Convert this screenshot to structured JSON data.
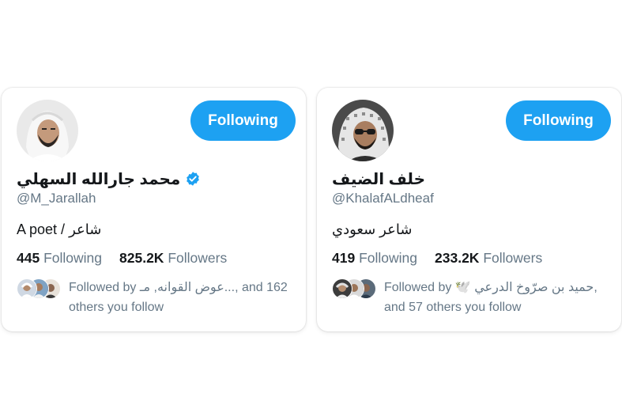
{
  "cards": [
    {
      "name": "محمد جارالله السهلي",
      "verified": true,
      "handle": "@M_Jarallah",
      "bio": "A poet / شاعر",
      "follow_button": "Following",
      "following_count": "445",
      "following_label": "Following",
      "followers_count": "825.2K",
      "followers_label": "Followers",
      "followed_by_line1": "Followed by عوض القوانه, مـ..., and 162",
      "followed_by_line2": "others you follow"
    },
    {
      "name": "خلف الضيف",
      "verified": false,
      "handle": "@KhalafALdheaf",
      "bio": "شاعر سعودي",
      "follow_button": "Following",
      "following_count": "419",
      "following_label": "Following",
      "followers_count": "233.2K",
      "followers_label": "Followers",
      "followed_by_line1": "Followed by 🕊️ حميد بن صرّوخ الدرعي,",
      "followed_by_line2": "and 57 others you follow"
    }
  ],
  "colors": {
    "accent": "#1da1f2",
    "secondary_text": "#657786",
    "primary_text": "#14171a"
  },
  "icons": [
    "verified-badge-icon",
    "avatar-photo",
    "follower-avatar"
  ]
}
